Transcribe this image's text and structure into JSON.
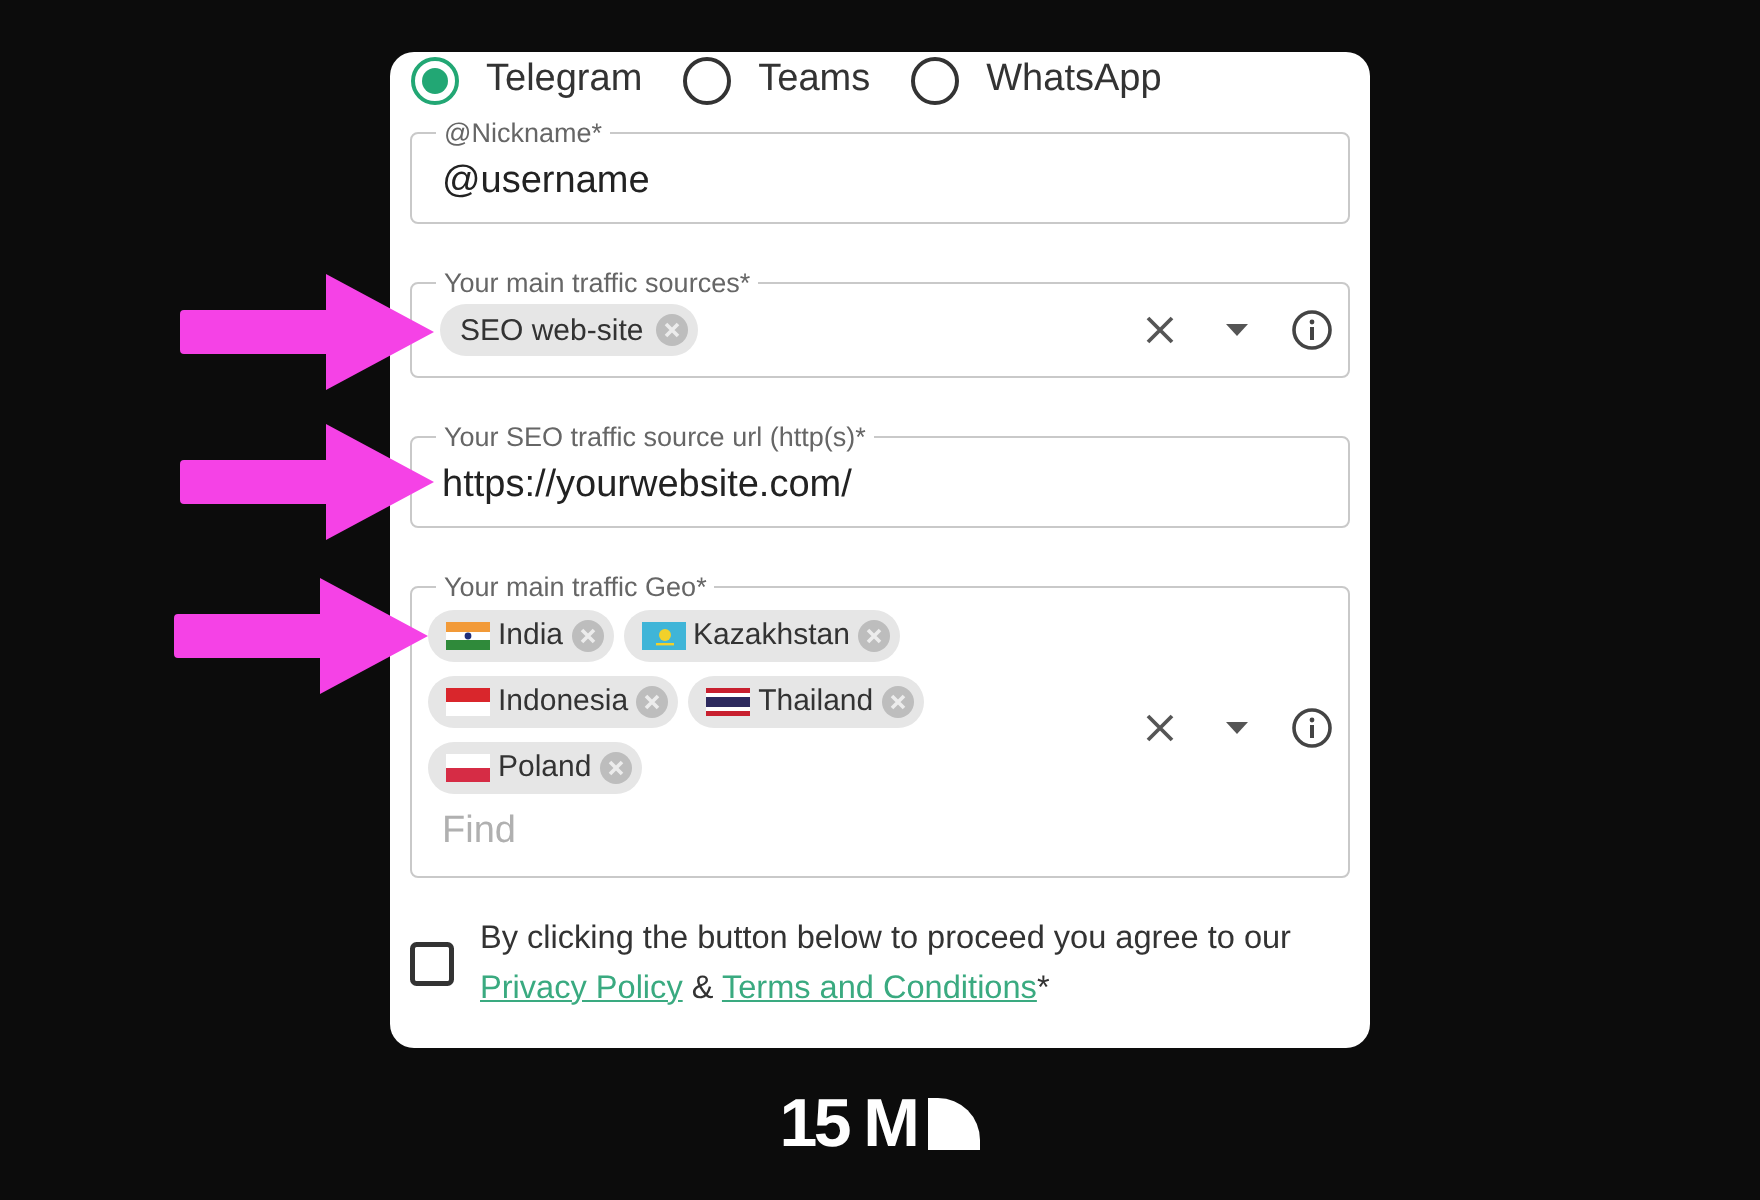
{
  "contact_method": {
    "options": [
      {
        "label": "Telegram",
        "selected": true
      },
      {
        "label": "Teams",
        "selected": false
      },
      {
        "label": "WhatsApp",
        "selected": false
      }
    ]
  },
  "nickname": {
    "label": "@Nickname*",
    "value": "@username"
  },
  "traffic_sources": {
    "label": "Your main traffic sources*",
    "chips": [
      "SEO web-site"
    ]
  },
  "source_url": {
    "label": "Your SEO traffic source url (http(s)*",
    "value": "https://yourwebsite.com/"
  },
  "traffic_geo": {
    "label": "Your main traffic Geo*",
    "chips": [
      "India",
      "Kazakhstan",
      "Indonesia",
      "Thailand",
      "Poland"
    ],
    "placeholder": "Find"
  },
  "agreement": {
    "checked": false,
    "parts": [
      {
        "kind": "text",
        "text": "By clicking the button below to proceed you agree to our "
      },
      {
        "kind": "link",
        "text": "Privacy Policy"
      },
      {
        "kind": "text",
        "text": " & "
      },
      {
        "kind": "link",
        "text": "Terms and Conditions"
      },
      {
        "kind": "text",
        "text": "*"
      }
    ]
  },
  "brand": {
    "logo_text": "15 M"
  }
}
